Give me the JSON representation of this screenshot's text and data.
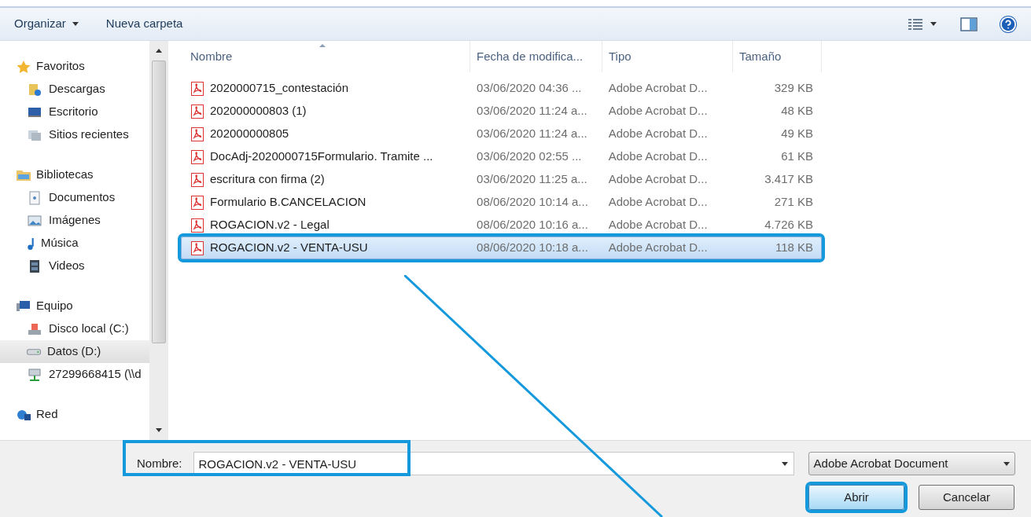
{
  "toolbar": {
    "organize": "Organizar",
    "new_folder": "Nueva carpeta"
  },
  "sidebar": {
    "groups": [
      {
        "label": "Favoritos",
        "kind": "star",
        "children": [
          {
            "label": "Descargas",
            "kind": "downloads",
            "selected": false
          },
          {
            "label": "Escritorio",
            "kind": "monitor",
            "selected": false
          },
          {
            "label": "Sitios recientes",
            "kind": "recent",
            "selected": false
          }
        ]
      },
      {
        "label": "Bibliotecas",
        "kind": "library",
        "children": [
          {
            "label": "Documentos",
            "kind": "document",
            "selected": false
          },
          {
            "label": "Imágenes",
            "kind": "image",
            "selected": false
          },
          {
            "label": "Música",
            "kind": "music",
            "selected": false
          },
          {
            "label": "Videos",
            "kind": "video",
            "selected": false
          }
        ]
      },
      {
        "label": "Equipo",
        "kind": "computer",
        "children": [
          {
            "label": "Disco local (C:)",
            "kind": "system-drive",
            "selected": false
          },
          {
            "label": "Datos (D:)",
            "kind": "drive",
            "selected": true
          },
          {
            "label": "27299668415 (\\\\d",
            "kind": "network-drive",
            "selected": false
          }
        ]
      },
      {
        "label": "Red",
        "kind": "network"
      }
    ]
  },
  "table": {
    "columns": [
      "Nombre",
      "Fecha de modifica...",
      "Tipo",
      "Tamaño"
    ],
    "rows": [
      {
        "name": "2020000715_contestación",
        "date": "03/06/2020 04:36 ...",
        "type": "Adobe Acrobat D...",
        "size": "329 KB",
        "selected": false,
        "highlighted": false
      },
      {
        "name": "202000000803 (1)",
        "date": "03/06/2020 11:24 a...",
        "type": "Adobe Acrobat D...",
        "size": "48 KB",
        "selected": false,
        "highlighted": false
      },
      {
        "name": "202000000805",
        "date": "03/06/2020 11:24 a...",
        "type": "Adobe Acrobat D...",
        "size": "49 KB",
        "selected": false,
        "highlighted": false
      },
      {
        "name": "DocAdj-2020000715Formulario. Tramite ...",
        "date": "03/06/2020 02:55 ...",
        "type": "Adobe Acrobat D...",
        "size": "61 KB",
        "selected": false,
        "highlighted": false
      },
      {
        "name": "escritura con firma (2)",
        "date": "03/06/2020 11:25 a...",
        "type": "Adobe Acrobat D...",
        "size": "3.417 KB",
        "selected": false,
        "highlighted": false
      },
      {
        "name": "Formulario B.CANCELACION",
        "date": "08/06/2020 10:14 a...",
        "type": "Adobe Acrobat D...",
        "size": "271 KB",
        "selected": false,
        "highlighted": false
      },
      {
        "name": "ROGACION.v2 - Legal",
        "date": "08/06/2020 10:16 a...",
        "type": "Adobe Acrobat D...",
        "size": "4.726 KB",
        "selected": false,
        "highlighted": false
      },
      {
        "name": "ROGACION.v2 - VENTA-USU",
        "date": "08/06/2020 10:18 a...",
        "type": "Adobe Acrobat D...",
        "size": "118 KB",
        "selected": true,
        "highlighted": true
      }
    ]
  },
  "filename": {
    "label": "Nombre:",
    "value": "ROGACION.v2 - VENTA-USU",
    "highlighted": true
  },
  "file_type": {
    "value": "Adobe Acrobat Document"
  },
  "buttons": [
    {
      "label": "Abrir",
      "kind": "primary",
      "highlighted": true
    },
    {
      "label": "Cancelar",
      "kind": "secondary",
      "highlighted": false
    }
  ]
}
